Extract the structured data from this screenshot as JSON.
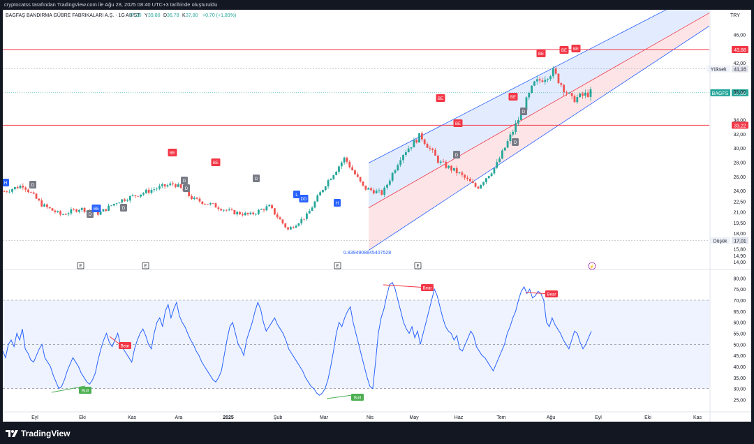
{
  "attribution": "cryptocatss tarafından TradingView.com ile Ağu 28, 2025 08:40 UTC+3 tarihinde oluşturuldu",
  "footer": {
    "brand": "TradingView"
  },
  "header": {
    "symbol_title": "BAGFAŞ BANDIRMA GÜBRE FABRIKALARI A.Ş. · 1G · BIST",
    "ohlc": [
      {
        "k": "A",
        "v": "37,30"
      },
      {
        "k": "Y",
        "v": "39,80"
      },
      {
        "k": "D",
        "v": "36,78"
      },
      {
        "k": "K",
        "v": "37,80"
      }
    ],
    "change": "+0,70 (+1,89%)",
    "currency": "TRY"
  },
  "colors": {
    "up": "#26a69a",
    "down": "#ef5350",
    "blue": "#2962ff",
    "rsi": "#2962ff",
    "red_line": "#f23645",
    "badge_red": "#f23645",
    "badge_gray": "#787b86",
    "badge_blue": "#2962ff",
    "bull": "#4caf50"
  },
  "chart_data": [
    {
      "type": "candlestick",
      "title": "BAGFAŞ BANDIRMA GÜBRE FABRIKALARI A.Ş. · 1G · BIST",
      "yscale": "linear",
      "ylim": [
        13.5,
        48.5
      ],
      "y_ticks": [
        "46,00",
        "42,00",
        "38,00",
        "34,00",
        "32,00",
        "30,00",
        "28,00",
        "26,00",
        "24,00",
        "22,50",
        "21,00",
        "19,50",
        "18,00",
        "15,80",
        "14,90",
        "14,00"
      ],
      "x_ticks": [
        "Eyl",
        "Eki",
        "Kas",
        "Ara",
        "2025",
        "Şub",
        "Mar",
        "Nis",
        "May",
        "Haz",
        "Tem",
        "Ağu",
        "Eyl",
        "Eki",
        "Kas"
      ],
      "key_prices": [
        {
          "label": "43,88",
          "value": 43.88,
          "style": "red"
        },
        {
          "label": "41,16",
          "value": 41.16,
          "style": "gray",
          "name": "Yüksek"
        },
        {
          "label": "37,80",
          "value": 37.8,
          "style": "teal",
          "name": "BAGFS"
        },
        {
          "label": "33,22",
          "value": 33.22,
          "style": "red"
        },
        {
          "label": "17,01",
          "value": 17.01,
          "style": "gray",
          "name": "Düşük"
        }
      ],
      "price_path": [
        {
          "x": "Ağu 2024",
          "y": 23.9
        },
        {
          "x": "Eyl 2024",
          "y": 24.8
        },
        {
          "x": "Eyl 2024",
          "y": 22.0
        },
        {
          "x": "Eki 2024",
          "y": 20.6
        },
        {
          "x": "Eki 2024",
          "y": 21.5
        },
        {
          "x": "Kas 2024",
          "y": 20.8
        },
        {
          "x": "Kas 2024",
          "y": 22.5
        },
        {
          "x": "Ara 2024",
          "y": 23.4
        },
        {
          "x": "Ara 2024",
          "y": 24.3
        },
        {
          "x": "2025",
          "y": 25.0
        },
        {
          "x": "Oca 2025",
          "y": 22.8
        },
        {
          "x": "Şub 2025",
          "y": 22.0
        },
        {
          "x": "Şub 2025",
          "y": 21.0
        },
        {
          "x": "Mar 2025",
          "y": 20.6
        },
        {
          "x": "Mar 2025",
          "y": 21.8
        },
        {
          "x": "Mar 2025",
          "y": 18.5
        },
        {
          "x": "Nis 2025",
          "y": 20.5
        },
        {
          "x": "Nis 2025",
          "y": 25.0
        },
        {
          "x": "Nis 2025",
          "y": 28.6
        },
        {
          "x": "Nis 2025",
          "y": 24.4
        },
        {
          "x": "May 2025",
          "y": 23.6
        },
        {
          "x": "May 2025",
          "y": 29.0
        },
        {
          "x": "May 2025",
          "y": 31.8
        },
        {
          "x": "Haz 2025",
          "y": 28.0
        },
        {
          "x": "Haz 2025",
          "y": 26.5
        },
        {
          "x": "Tem 2025",
          "y": 24.4
        },
        {
          "x": "Tem 2025",
          "y": 27.5
        },
        {
          "x": "Tem 2025",
          "y": 33.0
        },
        {
          "x": "Ağu 2025",
          "y": 39.0
        },
        {
          "x": "Ağu 2025",
          "y": 40.8
        },
        {
          "x": "Ağu 2025",
          "y": 36.8
        },
        {
          "x": "Ağu 2025",
          "y": 37.8
        }
      ],
      "annotations": {
        "label_text": "0.8394908845407528",
        "earnings_marker": "E",
        "badges": [
          {
            "text": "BE",
            "kind": "red"
          },
          {
            "text": "BE",
            "kind": "red"
          },
          {
            "text": "BE",
            "kind": "red"
          },
          {
            "text": "BE",
            "kind": "red"
          },
          {
            "text": "BE",
            "kind": "red"
          },
          {
            "text": "BE",
            "kind": "red"
          },
          {
            "text": "BE",
            "kind": "red"
          },
          {
            "text": "BE",
            "kind": "red"
          },
          {
            "text": "D",
            "kind": "gray"
          },
          {
            "text": "D",
            "kind": "gray"
          },
          {
            "text": "D",
            "kind": "gray"
          },
          {
            "text": "D",
            "kind": "gray"
          },
          {
            "text": "D",
            "kind": "gray"
          },
          {
            "text": "D",
            "kind": "gray"
          },
          {
            "text": "D",
            "kind": "gray"
          },
          {
            "text": "D",
            "kind": "gray"
          },
          {
            "text": "D",
            "kind": "gray"
          },
          {
            "text": "H",
            "kind": "blue"
          },
          {
            "text": "H",
            "kind": "blue"
          },
          {
            "text": "BE",
            "kind": "blue"
          },
          {
            "text": "DD",
            "kind": "blue"
          },
          {
            "text": "L",
            "kind": "blue"
          }
        ]
      }
    },
    {
      "type": "line",
      "title": "",
      "ylim": [
        22,
        82
      ],
      "y_ticks": [
        "80,00",
        "75,00",
        "70,00",
        "65,00",
        "60,00",
        "55,00",
        "50,00",
        "45,00",
        "40,00",
        "35,00",
        "30,00",
        "25,00"
      ],
      "bands": {
        "upper": 70,
        "middle": 50,
        "lower": 30
      },
      "series": [
        {
          "values": [
            47,
            44,
            50,
            52,
            49,
            55,
            52,
            57,
            48,
            46,
            43,
            42,
            45,
            48,
            50,
            44,
            42,
            40,
            36,
            33,
            30,
            31,
            34,
            38,
            41,
            44,
            42,
            40,
            37,
            35,
            33,
            32,
            34,
            37,
            43,
            48,
            52,
            55,
            51,
            49,
            52,
            55,
            50,
            48,
            46,
            44,
            42,
            48,
            52,
            55,
            57,
            54,
            50,
            48,
            55,
            60,
            62,
            58,
            65,
            68,
            62,
            66,
            69,
            63,
            60,
            58,
            55,
            52,
            50,
            47,
            45,
            42,
            40,
            38,
            36,
            34,
            33,
            35,
            38,
            45,
            52,
            58,
            60,
            55,
            50,
            48,
            45,
            52,
            56,
            60,
            65,
            69,
            66,
            60,
            56,
            58,
            60,
            62,
            59,
            57,
            55,
            52,
            48,
            46,
            44,
            42,
            40,
            38,
            35,
            33,
            31,
            30,
            28,
            27,
            28,
            30,
            34,
            40,
            47,
            55,
            60,
            58,
            62,
            65,
            67,
            60,
            55,
            50,
            45,
            40,
            35,
            31,
            30,
            42,
            55,
            62,
            66,
            72,
            77,
            78,
            75,
            70,
            65,
            60,
            57,
            55,
            58,
            53,
            56,
            50,
            55,
            60,
            65,
            70,
            75,
            72,
            67,
            62,
            58,
            56,
            55,
            52,
            54,
            48,
            47,
            50,
            53,
            56,
            54,
            49,
            47,
            45,
            44,
            42,
            40,
            38,
            41,
            44,
            47,
            50,
            55,
            58,
            62,
            65,
            70,
            74,
            76,
            73,
            75,
            71,
            72,
            74,
            73,
            70,
            60,
            58,
            62,
            59,
            57,
            55,
            52,
            50,
            48,
            52,
            56,
            55,
            51,
            48,
            50,
            53,
            56
          ]
        }
      ],
      "divergences": [
        {
          "text": "Bull",
          "kind": "bull"
        },
        {
          "text": "Bear",
          "kind": "bear"
        },
        {
          "text": "Bull",
          "kind": "bull"
        },
        {
          "text": "Bear",
          "kind": "bear"
        },
        {
          "text": "Bear",
          "kind": "bear"
        }
      ]
    }
  ]
}
